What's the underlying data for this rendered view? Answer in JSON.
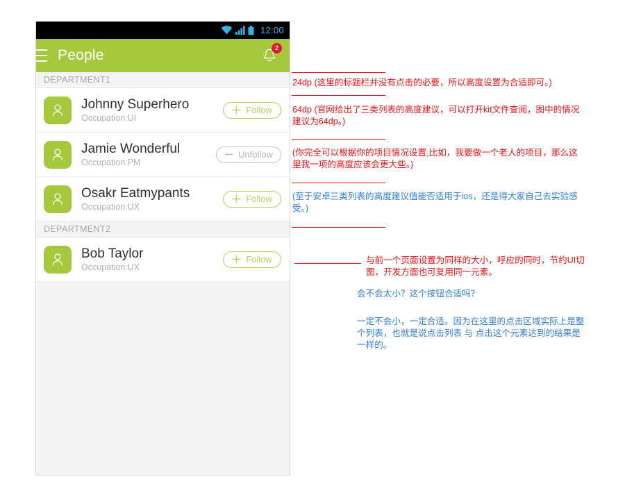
{
  "phone": {
    "statusbar": {
      "clock": "12:00",
      "icons": [
        "wifi-icon",
        "signal-icon",
        "battery-icon"
      ]
    },
    "appbar": {
      "menu_icon": "hamburger-icon",
      "title": "People",
      "bell_icon": "bell-icon",
      "badge_count": "2"
    },
    "sections": [
      {
        "header": "DEPARTMENT1",
        "rows": [
          {
            "name": "Johnny Superhero",
            "sub": "Occupation:UI",
            "action": "Follow",
            "action_icon": "plus-icon",
            "state": "follow"
          },
          {
            "name": "Jamie Wonderful",
            "sub": "Occupation:PM",
            "action": "Unfollow",
            "action_icon": "minus-icon",
            "state": "unfollow"
          },
          {
            "name": "Osakr Eatmypants",
            "sub": "Occupation:UX",
            "action": "Follow",
            "action_icon": "plus-icon",
            "state": "follow"
          }
        ]
      },
      {
        "header": "DEPARTMENT2",
        "rows": [
          {
            "name": "Bob Taylor",
            "sub": "Occupation:UX",
            "action": "Follow",
            "action_icon": "plus-icon",
            "state": "follow"
          }
        ]
      }
    ]
  },
  "annotations": {
    "a1": "24dp (这里的标题栏并没有点击的必要，所以高度设置为合适即可。)",
    "a2": "64dp (官网给出了三类列表的高度建议，可以打开kit文件查阅，图中的情况建议为64dp。)",
    "a3": "(你完全可以根据你的项目情况设置,比如，我要做一个老人的项目，那么这里我一项的高度应该会更大些。)",
    "a4": "(至于安卓三类列表的高度建议值能否适用于ios，还是得大家自己去实验感受。)",
    "a5": "与前一个页面设置为同样的大小，呼应的同时，节约UI切图，开发方面也可复用同一元素。",
    "a6": "会不会太小？这个按钮合适吗？",
    "a7": "一定不会小，一定合适。因为在这里的点击区域实际上是整个列表，也就是说点击列表 与 点击这个元素达到的结果是一样的。"
  },
  "colors": {
    "brand_green": "#a4c93c",
    "pill_green": "#b6d45c",
    "badge_red": "#e8142d",
    "annotation_red": "#f20f12",
    "annotation_blue": "#2f7fd8",
    "status_cyan": "#33b5e5"
  }
}
